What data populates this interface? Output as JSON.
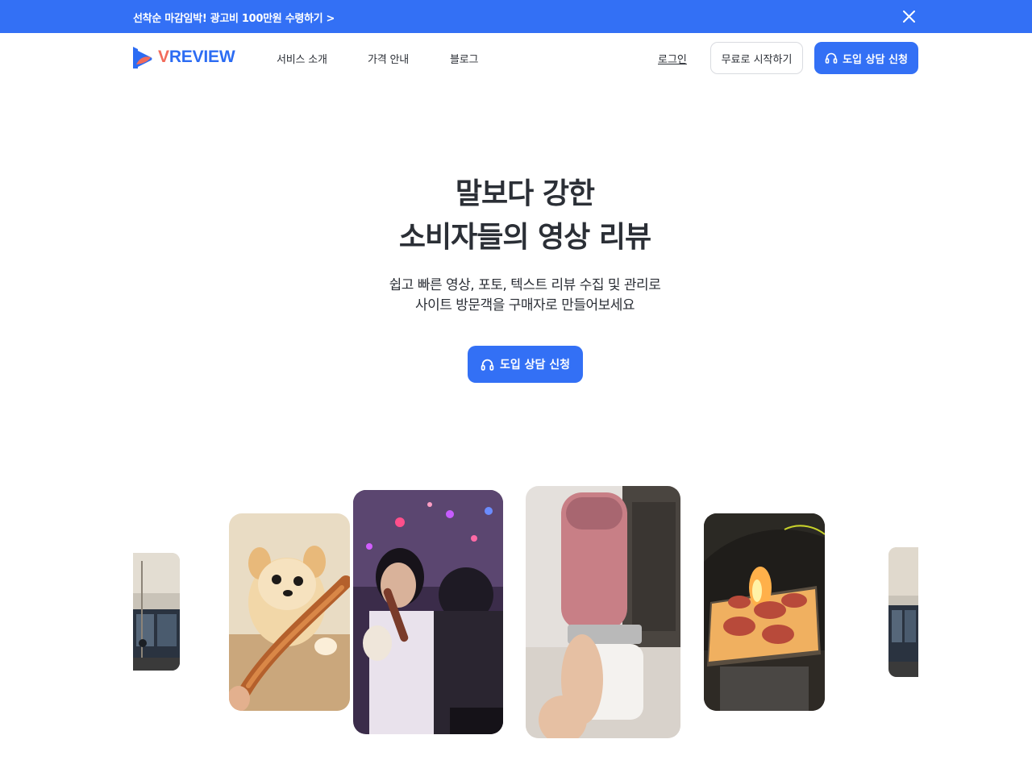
{
  "promo": {
    "text": "선착순 마감임박! 광고비 100만원 수령하기 >",
    "close_icon": "close-icon"
  },
  "header": {
    "logo_prefix": "V",
    "logo_rest": "REVIEW",
    "nav": [
      "서비스 소개",
      "가격 안내",
      "블로그"
    ],
    "login": "로그인",
    "start_free": "무료로 시작하기",
    "consult": "도입 상담 신청"
  },
  "hero": {
    "title_line1": "말보다 강한",
    "title_line2": "소비자들의 영상 리뷰",
    "sub_line1": "쉽고 빠른 영상, 포토, 텍스트 리뷰 수집 및 관리로",
    "sub_line2": "사이트 방문객을 구매자로 만들어보세요",
    "cta": "도입 상담 신청",
    "cta_icon": "headset-icon"
  },
  "colors": {
    "brand_blue": "#3370f5",
    "brand_coral": "#f26b5b",
    "text": "#2b2f36"
  },
  "video_cards": [
    "interior-video",
    "pomeranian-video",
    "karaoke-video",
    "smoothie-blender-video",
    "scallop-grill-video",
    "interior-video"
  ]
}
